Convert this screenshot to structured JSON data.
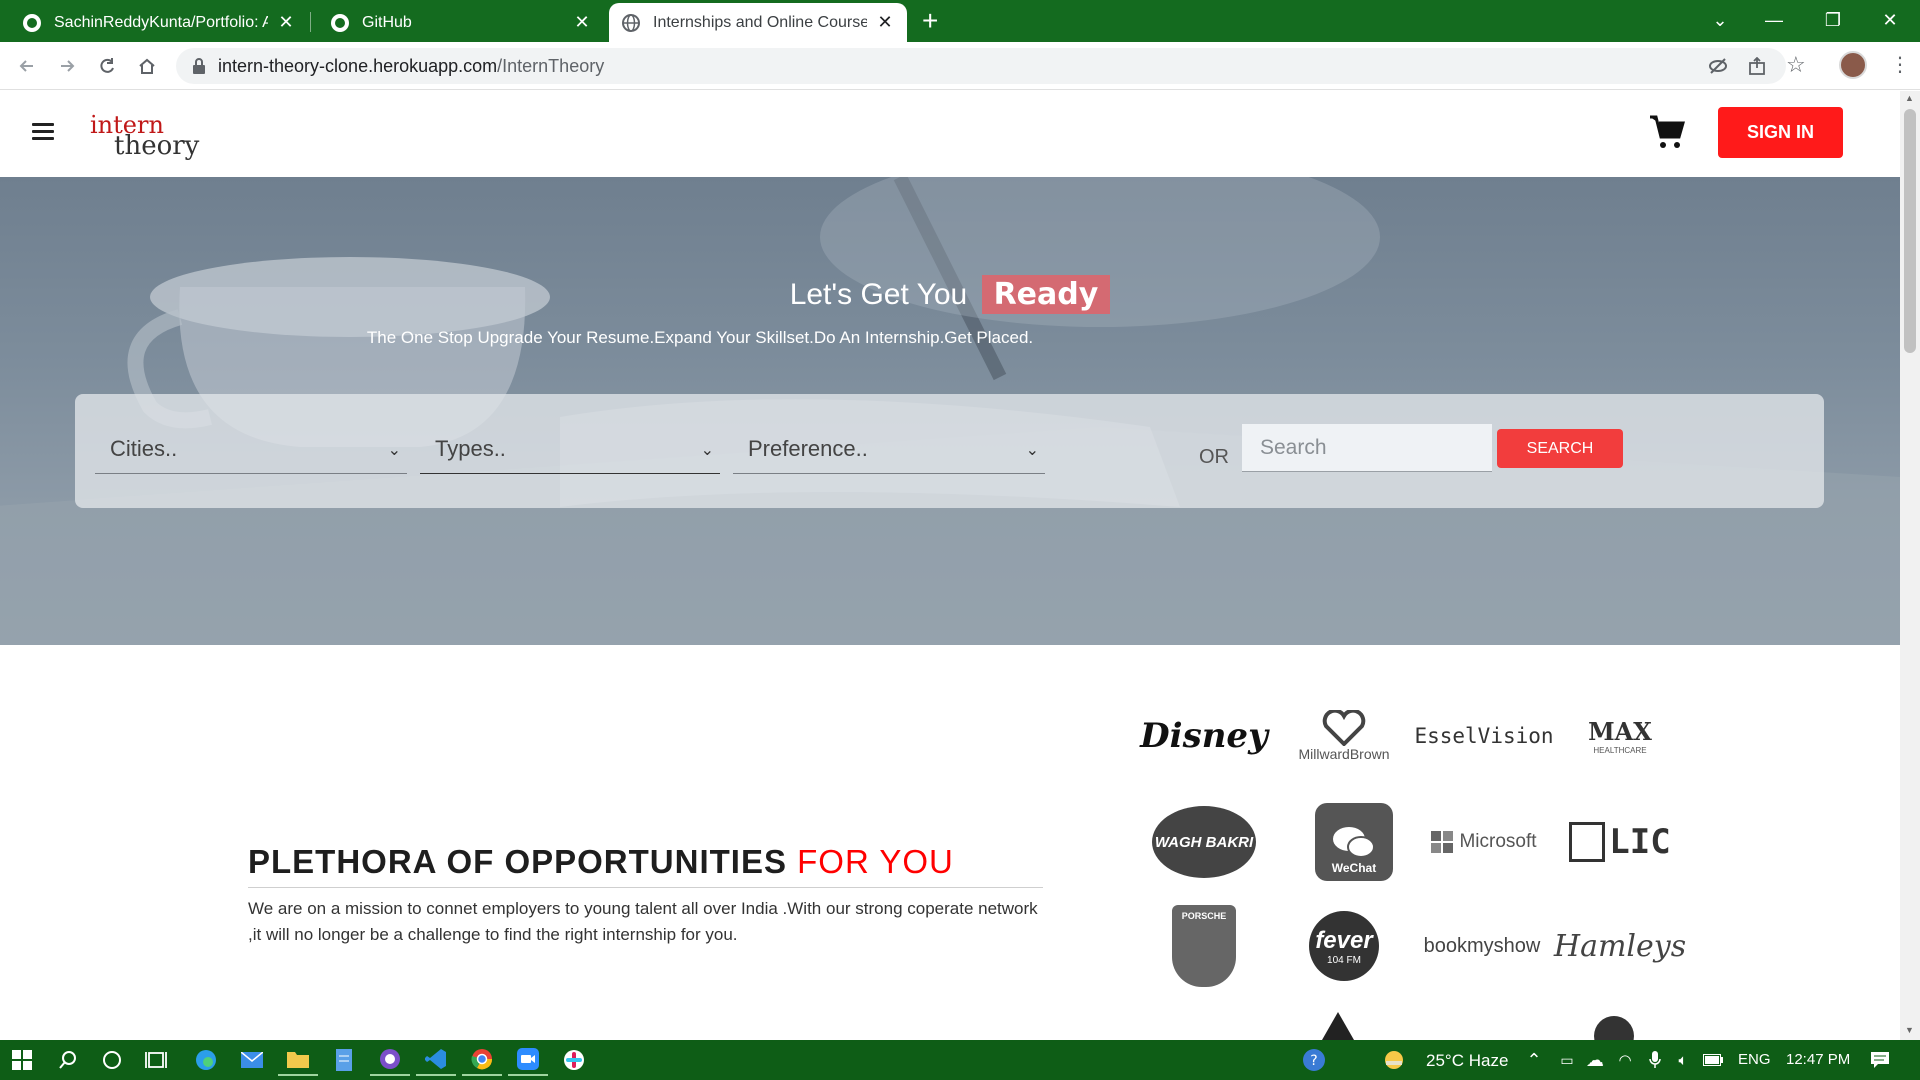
{
  "browser": {
    "tabs": [
      {
        "title": "SachinReddyKunta/Portfolio: A p",
        "active": false
      },
      {
        "title": "GitHub",
        "active": false
      },
      {
        "title": "Internships and Online Courses f",
        "active": true
      }
    ],
    "new_tab": "+",
    "url_host": "intern-theory-clone.herokuapp.com",
    "url_path": "/InternTheory"
  },
  "site": {
    "logo_line1": "intern",
    "logo_line2": "theory",
    "signin_label": "SIGN IN"
  },
  "hero": {
    "title_prefix": "Let's Get You",
    "title_highlight": "Ready",
    "subtitle": "The One Stop Upgrade Your Resume.Expand Your Skillset.Do An Internship.Get Placed.",
    "filters": [
      {
        "label": "Cities.."
      },
      {
        "label": "Types.."
      },
      {
        "label": "Preference.."
      }
    ],
    "or_label": "OR",
    "search_placeholder": "Search",
    "search_button": "SEARCH"
  },
  "opportunities": {
    "title": "PLETHORA OF OPPORTUNITIES",
    "title_accent": "FOR YOU",
    "description": "We are on a mission to connet employers to young talent all over India .With our strong coperate network ,it will no longer be a challenge to find the right internship for you."
  },
  "partner_logos": [
    {
      "name": "Disney"
    },
    {
      "name": "MillwardBrown"
    },
    {
      "name": "EsselVision"
    },
    {
      "name": "MAX",
      "sub": "HEALTHCARE"
    },
    {
      "name": "WAGH BAKRI"
    },
    {
      "name": "WeChat"
    },
    {
      "name": "Microsoft"
    },
    {
      "name": "LIC"
    },
    {
      "name": "PORSCHE"
    },
    {
      "name": "fever",
      "sub": "104 FM"
    },
    {
      "name": "bookmyshow"
    },
    {
      "name": "Hamleys"
    }
  ],
  "taskbar": {
    "weather": "25°C  Haze",
    "language": "ENG",
    "time": "12:47 PM"
  },
  "colors": {
    "tab_bar": "#146b1f",
    "brand_red": "#ff1a1a",
    "accent_red": "#ff0000",
    "taskbar": "#0e5d16"
  }
}
